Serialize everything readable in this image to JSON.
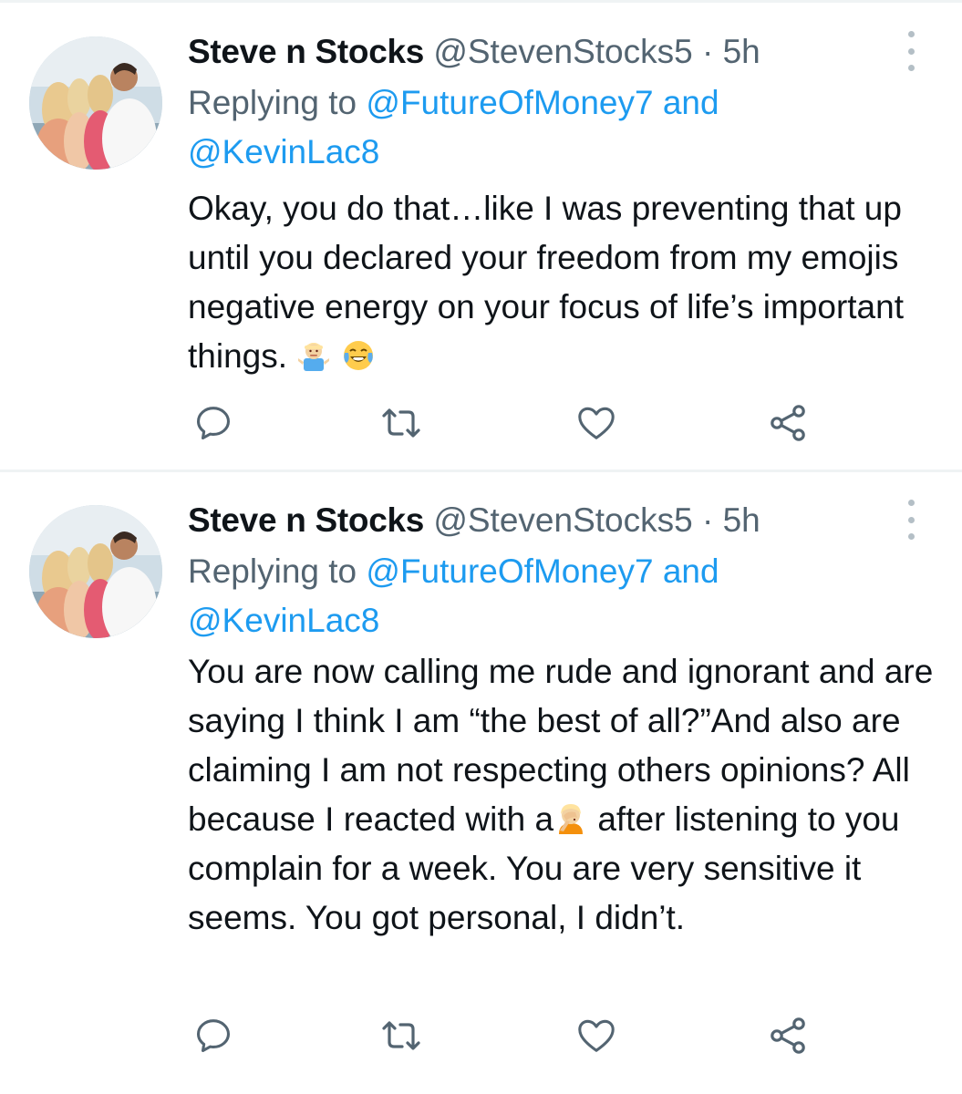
{
  "tweets": [
    {
      "author_name": "Steve n Stocks",
      "handle": "@StevenStocks5",
      "separator": "·",
      "time": "5h",
      "replying_prefix": "Replying to",
      "reply_user_1": "@FutureOfMoney7",
      "reply_and": "and",
      "reply_user_2": "@KevinLac8",
      "text_part_1": "Okay, you do that…like I was preventing that up until you declared your freedom from my emojis negative energy on your focus of life’s important things.",
      "emoji_1": "man-shrugging-emoji",
      "emoji_2": "face-with-tears-of-joy-emoji"
    },
    {
      "author_name": "Steve n Stocks",
      "handle": "@StevenStocks5",
      "separator": "·",
      "time": "5h",
      "replying_prefix": "Replying to",
      "reply_user_1": "@FutureOfMoney7",
      "reply_and": "and",
      "reply_user_2": "@KevinLac8",
      "text_part_1": "You are now calling me rude and ignorant and are saying I think I am “the best of all?”And also are claiming I am not respecting others opinions? All because I reacted with a",
      "emoji_1": "woman-facepalming-emoji",
      "text_part_2": "after listening to you complain for a week. You are very sensitive it seems. You got personal, I didn’t."
    }
  ],
  "actions": [
    "reply-icon",
    "retweet-icon",
    "like-icon",
    "share-icon"
  ],
  "colors": {
    "text": "#0f1419",
    "secondary": "#536471",
    "link": "#1d9bf0",
    "icon": "#536471",
    "divider": "#eff3f4"
  }
}
